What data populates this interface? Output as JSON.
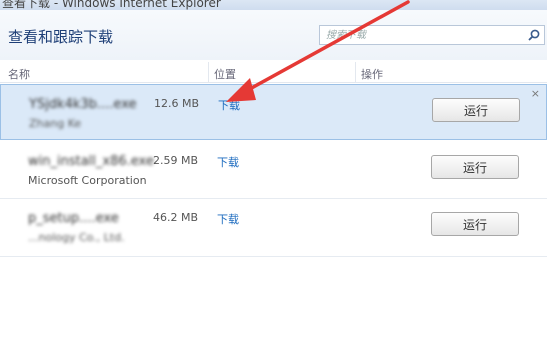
{
  "window": {
    "title": "查看下载 - Windows Internet Explorer"
  },
  "header": {
    "title": "查看和跟踪下载",
    "search_placeholder": "搜索下载"
  },
  "columns": {
    "name": "名称",
    "location": "位置",
    "action": "操作"
  },
  "downloads": [
    {
      "filename": "YSjdk4k3b....exe",
      "publisher": "Zhang Ke",
      "size": "12.6 MB",
      "location": "下载",
      "action": "运行"
    },
    {
      "filename": "win_install_x86.exe",
      "publisher": "Microsoft Corporation",
      "size": "2.59 MB",
      "location": "下载",
      "action": "运行"
    },
    {
      "filename": "p_setup....exe",
      "publisher": "...nology Co., Ltd.",
      "size": "46.2 MB",
      "location": "下载",
      "action": "运行"
    }
  ],
  "colors": {
    "arrow": "#e53935",
    "link": "#1c6bbf",
    "title": "#1e3f77",
    "selected_row": "#dbe9f8"
  }
}
